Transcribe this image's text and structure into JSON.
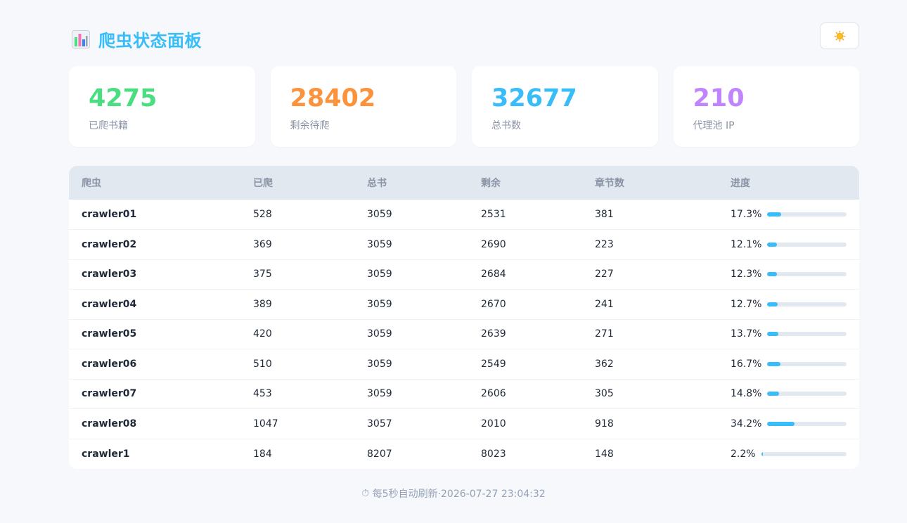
{
  "header": {
    "title": "爬虫状态面板",
    "app_icon": "bar-chart-icon",
    "theme_toggle_icon": "sun-icon"
  },
  "stats": [
    {
      "value": "4275",
      "label": "已爬书籍",
      "color": "#4ade80"
    },
    {
      "value": "28402",
      "label": "剩余待爬",
      "color": "#fb923c"
    },
    {
      "value": "32677",
      "label": "总书数",
      "color": "#38bdf8"
    },
    {
      "value": "210",
      "label": "代理池 IP",
      "color": "#c084fc"
    }
  ],
  "table": {
    "columns": [
      "爬虫",
      "已爬",
      "总书",
      "剩余",
      "章节数",
      "进度"
    ],
    "rows": [
      {
        "name": "crawler01",
        "crawled": "528",
        "total": "3059",
        "remaining": "2531",
        "chapters": "381",
        "progress": "17.3%",
        "progress_value": 17.3
      },
      {
        "name": "crawler02",
        "crawled": "369",
        "total": "3059",
        "remaining": "2690",
        "chapters": "223",
        "progress": "12.1%",
        "progress_value": 12.1
      },
      {
        "name": "crawler03",
        "crawled": "375",
        "total": "3059",
        "remaining": "2684",
        "chapters": "227",
        "progress": "12.3%",
        "progress_value": 12.3
      },
      {
        "name": "crawler04",
        "crawled": "389",
        "total": "3059",
        "remaining": "2670",
        "chapters": "241",
        "progress": "12.7%",
        "progress_value": 12.7
      },
      {
        "name": "crawler05",
        "crawled": "420",
        "total": "3059",
        "remaining": "2639",
        "chapters": "271",
        "progress": "13.7%",
        "progress_value": 13.7
      },
      {
        "name": "crawler06",
        "crawled": "510",
        "total": "3059",
        "remaining": "2549",
        "chapters": "362",
        "progress": "16.7%",
        "progress_value": 16.7
      },
      {
        "name": "crawler07",
        "crawled": "453",
        "total": "3059",
        "remaining": "2606",
        "chapters": "305",
        "progress": "14.8%",
        "progress_value": 14.8
      },
      {
        "name": "crawler08",
        "crawled": "1047",
        "total": "3057",
        "remaining": "2010",
        "chapters": "918",
        "progress": "34.2%",
        "progress_value": 34.2
      },
      {
        "name": "crawler1",
        "crawled": "184",
        "total": "8207",
        "remaining": "8023",
        "chapters": "148",
        "progress": "2.2%",
        "progress_value": 2.2
      }
    ]
  },
  "footer": {
    "icon": "stopwatch-icon",
    "text": "每5秒自动刷新·2026-07-27 23:04:32"
  },
  "colors": {
    "accent": "#38bdf8",
    "progress_track": "#e2e8f0"
  }
}
